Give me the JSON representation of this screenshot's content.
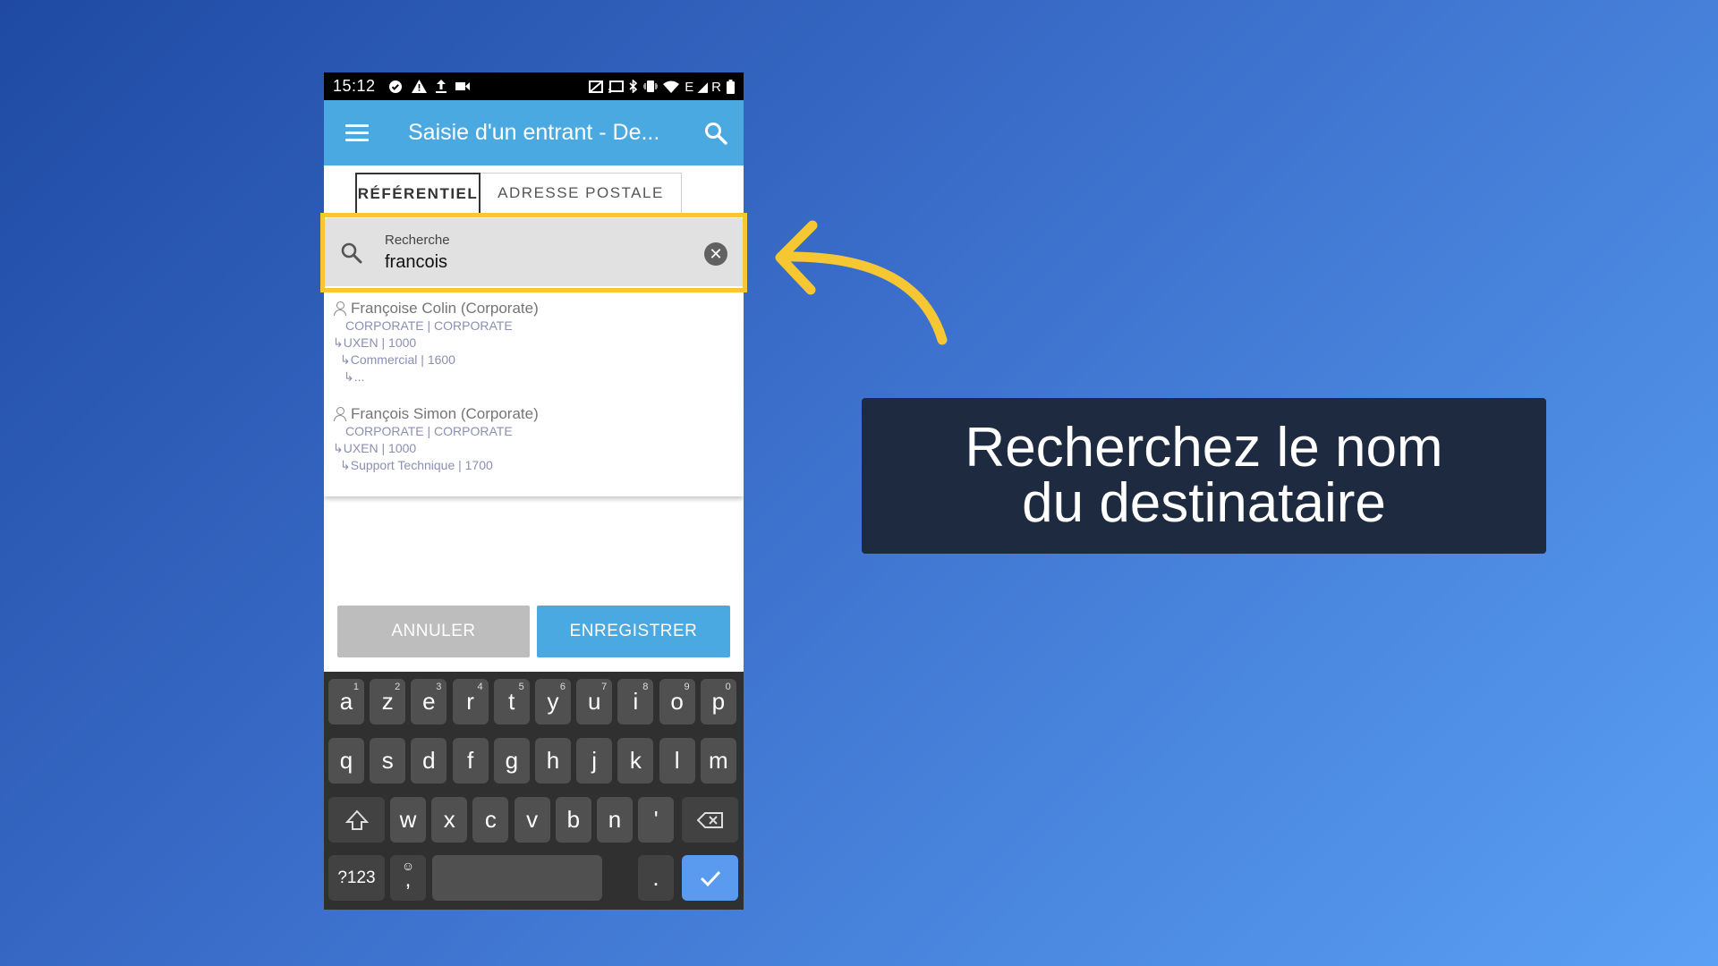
{
  "status_bar": {
    "time": "15:12",
    "right_text": "E ◢ R"
  },
  "app_bar": {
    "title": "Saisie d'un entrant - De...",
    "menu_icon": "hamburger-icon",
    "search_icon": "search-icon"
  },
  "tabs": [
    {
      "label": "RÉFÉRENTIEL",
      "active": true
    },
    {
      "label": "ADRESSE POSTALE",
      "active": false
    }
  ],
  "search": {
    "label": "Recherche",
    "value": "francois",
    "clear_icon": "close-circle-icon"
  },
  "results": [
    {
      "name": "Françoise Colin (Corporate)",
      "lines": [
        "CORPORATE | CORPORATE",
        "↳UXEN | 1000",
        "↳Commercial | 1600",
        "↳..."
      ]
    },
    {
      "name": "François Simon (Corporate)",
      "lines": [
        "CORPORATE | CORPORATE",
        "↳UXEN | 1000",
        "↳Support Technique | 1700"
      ]
    }
  ],
  "buttons": {
    "cancel": "ANNULER",
    "save": "ENREGISTRER"
  },
  "keyboard": {
    "row1": [
      "a",
      "z",
      "e",
      "r",
      "t",
      "y",
      "u",
      "i",
      "o",
      "p"
    ],
    "row1_hints": [
      "1",
      "2",
      "3",
      "4",
      "5",
      "6",
      "7",
      "8",
      "9",
      "0"
    ],
    "row2": [
      "q",
      "s",
      "d",
      "f",
      "g",
      "h",
      "j",
      "k",
      "l",
      "m"
    ],
    "row3": [
      "w",
      "x",
      "c",
      "v",
      "b",
      "n",
      "'"
    ],
    "symbols": "?123",
    "comma": ",",
    "period": ".",
    "emoji_glyph": "☺"
  },
  "callout": {
    "line1": "Recherchez le nom",
    "line2": "du destinataire"
  },
  "colors": {
    "appbar": "#4aa9e0",
    "highlight": "#f6c633",
    "callout_bg": "#1d2a40",
    "enter_key": "#5a9bf0"
  }
}
